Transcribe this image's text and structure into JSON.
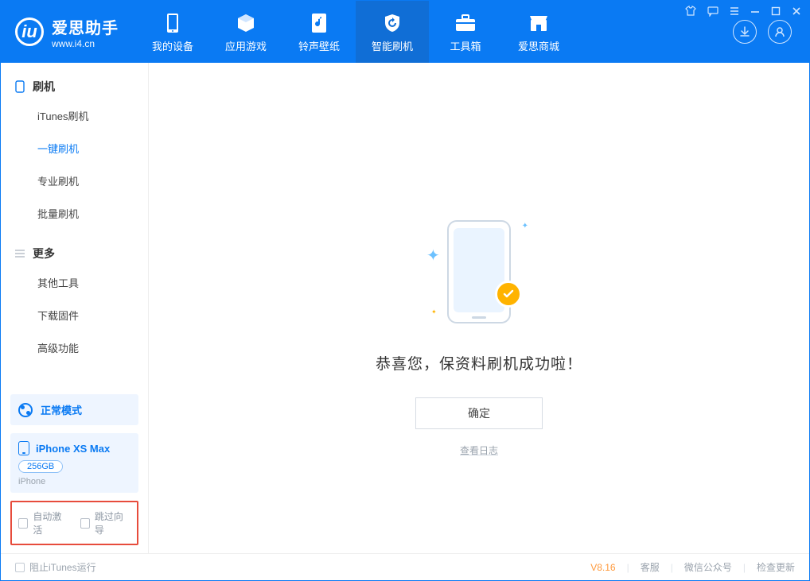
{
  "app": {
    "name_cn": "爱思助手",
    "url": "www.i4.cn"
  },
  "nav": {
    "items": [
      {
        "label": "我的设备"
      },
      {
        "label": "应用游戏"
      },
      {
        "label": "铃声壁纸"
      },
      {
        "label": "智能刷机"
      },
      {
        "label": "工具箱"
      },
      {
        "label": "爱思商城"
      }
    ],
    "active_index": 3
  },
  "sidebar": {
    "group1": {
      "title": "刷机",
      "items": [
        "iTunes刷机",
        "一键刷机",
        "专业刷机",
        "批量刷机"
      ],
      "active_index": 1
    },
    "group2": {
      "title": "更多",
      "items": [
        "其他工具",
        "下载固件",
        "高级功能"
      ]
    },
    "mode_label": "正常模式",
    "device": {
      "name": "iPhone XS Max",
      "capacity": "256GB",
      "type": "iPhone"
    },
    "checks": {
      "auto_activate": "自动激活",
      "skip_wizard": "跳过向导"
    }
  },
  "main": {
    "success_text": "恭喜您，保资料刷机成功啦！",
    "ok_button": "确定",
    "view_log": "查看日志"
  },
  "footer": {
    "block_itunes": "阻止iTunes运行",
    "version": "V8.16",
    "links": [
      "客服",
      "微信公众号",
      "检查更新"
    ]
  }
}
